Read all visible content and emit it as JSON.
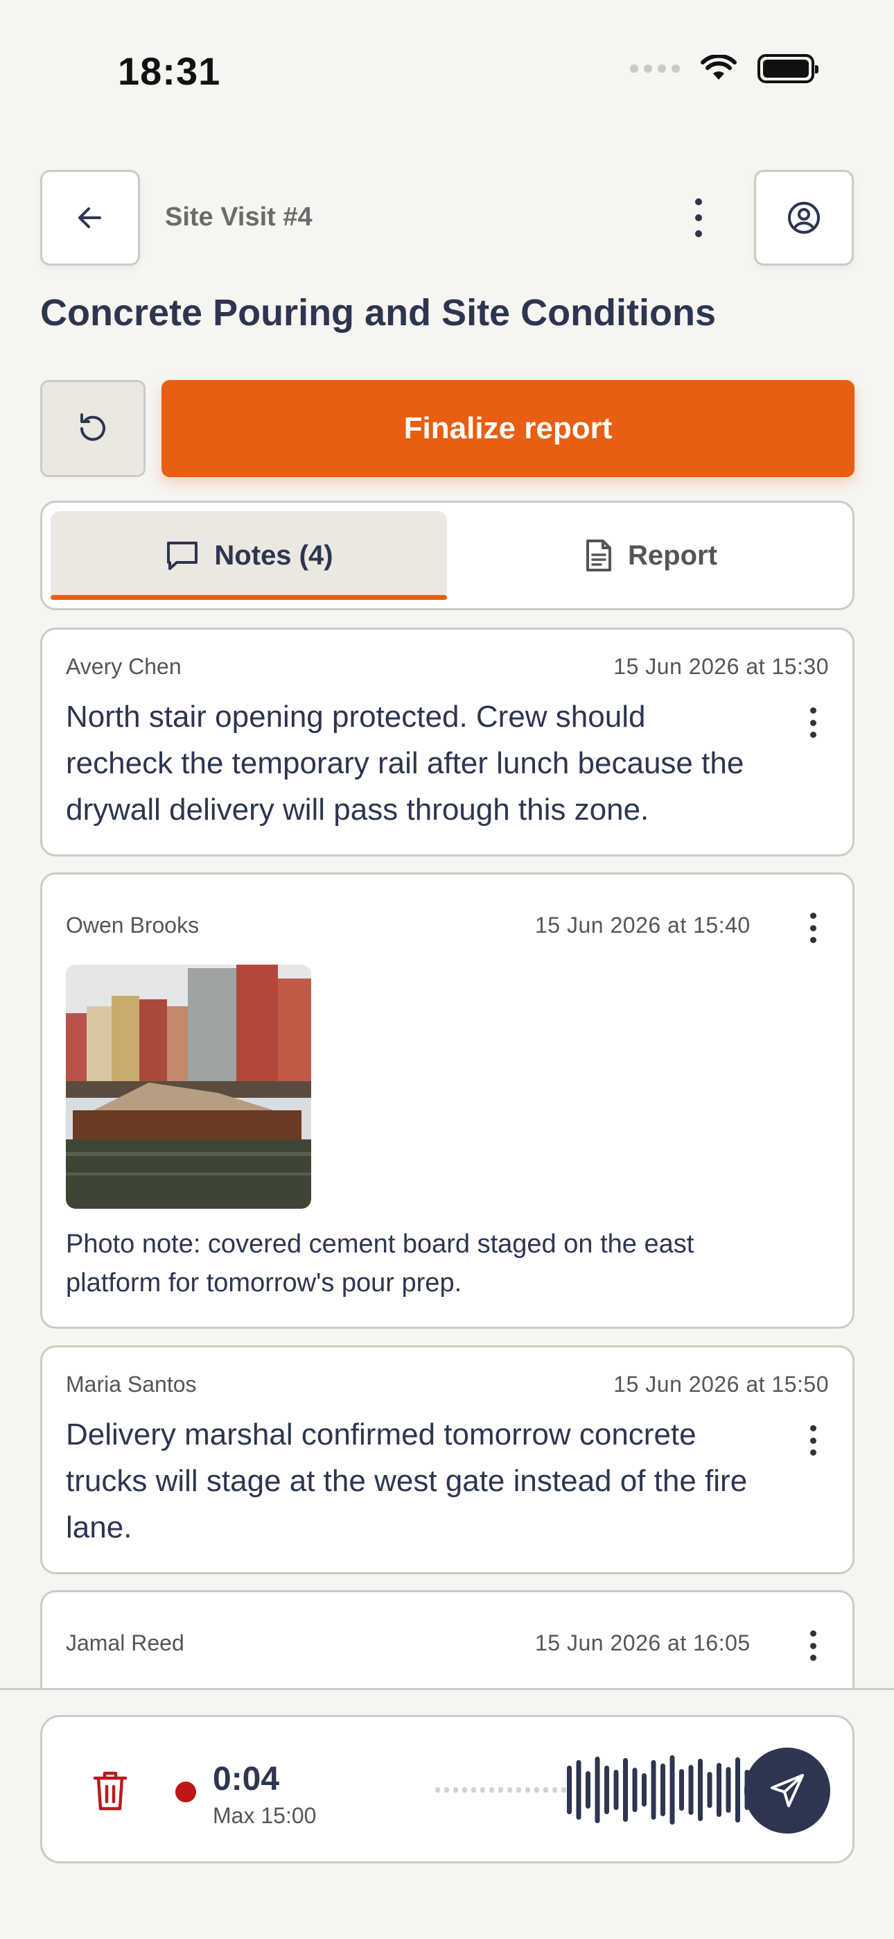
{
  "status_bar": {
    "time": "18:31"
  },
  "header": {
    "breadcrumb": "Site Visit #4",
    "title": "Concrete Pouring and Site Conditions"
  },
  "actions": {
    "finalize_label": "Finalize report"
  },
  "tabs": {
    "notes_label": "Notes (4)",
    "report_label": "Report",
    "accent_color": "#e85e12"
  },
  "notes": [
    {
      "author": "Avery Chen",
      "timestamp": "15 Jun 2026 at 15:30",
      "text": "North stair opening protected. Crew should recheck the temporary rail after lunch because the drywall delivery will pass through this zone."
    },
    {
      "author": "Owen Brooks",
      "timestamp": "15 Jun 2026 at 15:40",
      "caption": "Photo note: covered cement board staged on the east platform for tomorrow's pour prep."
    },
    {
      "author": "Maria Santos",
      "timestamp": "15 Jun 2026 at 15:50",
      "text": "Delivery marshal confirmed tomorrow concrete trucks will stage at the west gate instead of the fire lane."
    },
    {
      "author": "Jamal Reed",
      "timestamp": "15 Jun 2026 at 16:05"
    }
  ],
  "recorder": {
    "elapsed": "0:04",
    "max": "Max 15:00",
    "record_color": "#c0161a",
    "icons": [
      "trash-icon",
      "record-dot-icon",
      "send-icon"
    ]
  }
}
